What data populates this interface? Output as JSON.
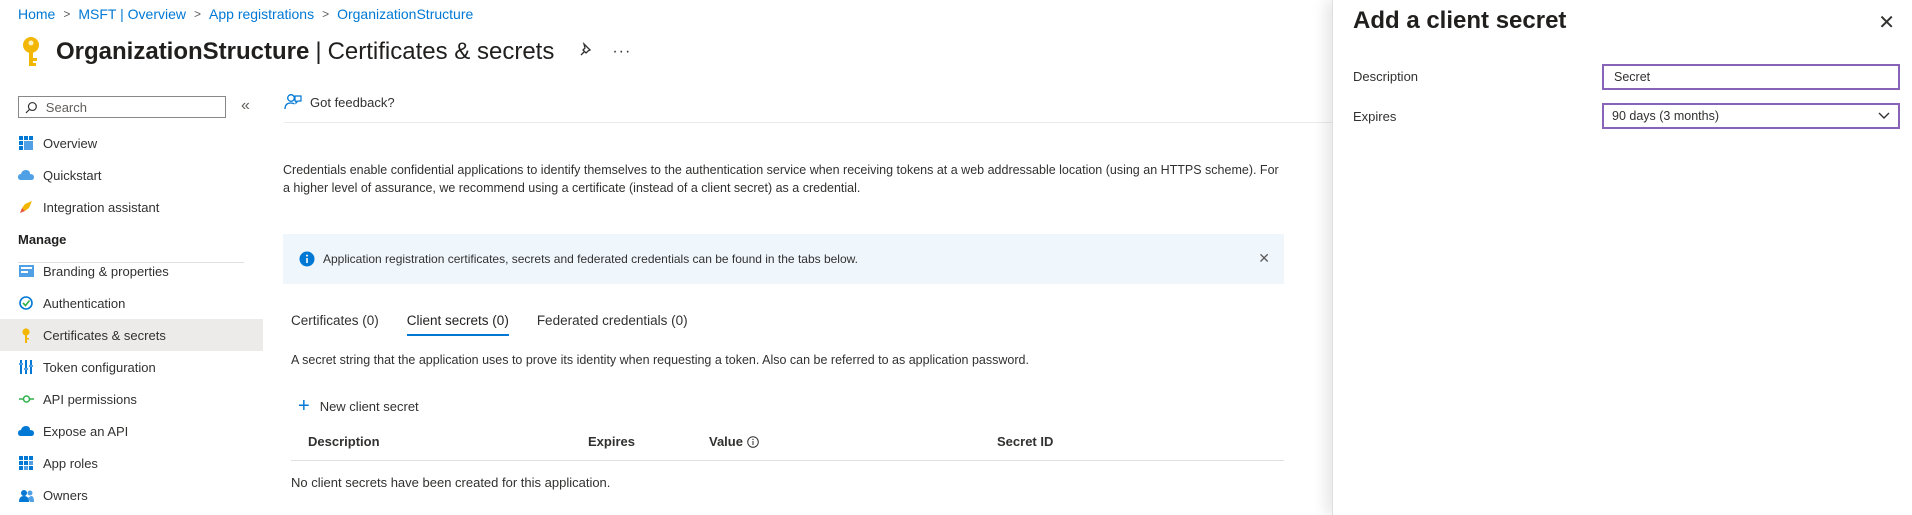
{
  "breadcrumb": {
    "items": [
      "Home",
      "MSFT | Overview",
      "App registrations",
      "OrganizationStructure"
    ],
    "separator": ">"
  },
  "header": {
    "app_name": "OrganizationStructure",
    "divider": "|",
    "page_name": "Certificates & secrets",
    "more": "···"
  },
  "sidebar": {
    "search_placeholder": "Search",
    "collapse_glyph": "«",
    "items_top": [
      {
        "label": "Overview",
        "icon": "overview-icon"
      },
      {
        "label": "Quickstart",
        "icon": "quickstart-icon"
      },
      {
        "label": "Integration assistant",
        "icon": "rocket-icon"
      }
    ],
    "section_manage": "Manage",
    "items_manage": [
      {
        "label": "Branding & properties",
        "icon": "branding-icon"
      },
      {
        "label": "Authentication",
        "icon": "authentication-icon"
      },
      {
        "label": "Certificates & secrets",
        "icon": "key-icon",
        "selected": true
      },
      {
        "label": "Token configuration",
        "icon": "token-icon"
      },
      {
        "label": "API permissions",
        "icon": "api-permissions-icon"
      },
      {
        "label": "Expose an API",
        "icon": "cloud-icon"
      },
      {
        "label": "App roles",
        "icon": "app-roles-icon"
      },
      {
        "label": "Owners",
        "icon": "owners-icon"
      }
    ]
  },
  "main": {
    "feedback": "Got feedback?",
    "intro": "Credentials enable confidential applications to identify themselves to the authentication service when receiving tokens at a web addressable location (using an HTTPS scheme). For a higher level of assurance, we recommend using a certificate (instead of a client secret) as a credential.",
    "info_banner": "Application registration certificates, secrets and federated credentials can be found in the tabs below.",
    "tabs": [
      {
        "label": "Certificates (0)",
        "active": false
      },
      {
        "label": "Client secrets (0)",
        "active": true
      },
      {
        "label": "Federated credentials (0)",
        "active": false
      }
    ],
    "tab_description": "A secret string that the application uses to prove its identity when requesting a token. Also can be referred to as application password.",
    "new_secret_label": "New client secret",
    "table": {
      "columns": [
        "Description",
        "Expires",
        "Value",
        "Secret ID"
      ],
      "empty_message": "No client secrets have been created for this application."
    }
  },
  "panel": {
    "title": "Add a client secret",
    "description_label": "Description",
    "description_value": "Secret",
    "expires_label": "Expires",
    "expires_value": "90 days (3 months)"
  },
  "colors": {
    "accent": "#0078d4",
    "focus_border": "#8764b8",
    "info_background": "#eff6fc",
    "selected_nav": "#edebe9",
    "key_yellow": "#f2b705"
  }
}
